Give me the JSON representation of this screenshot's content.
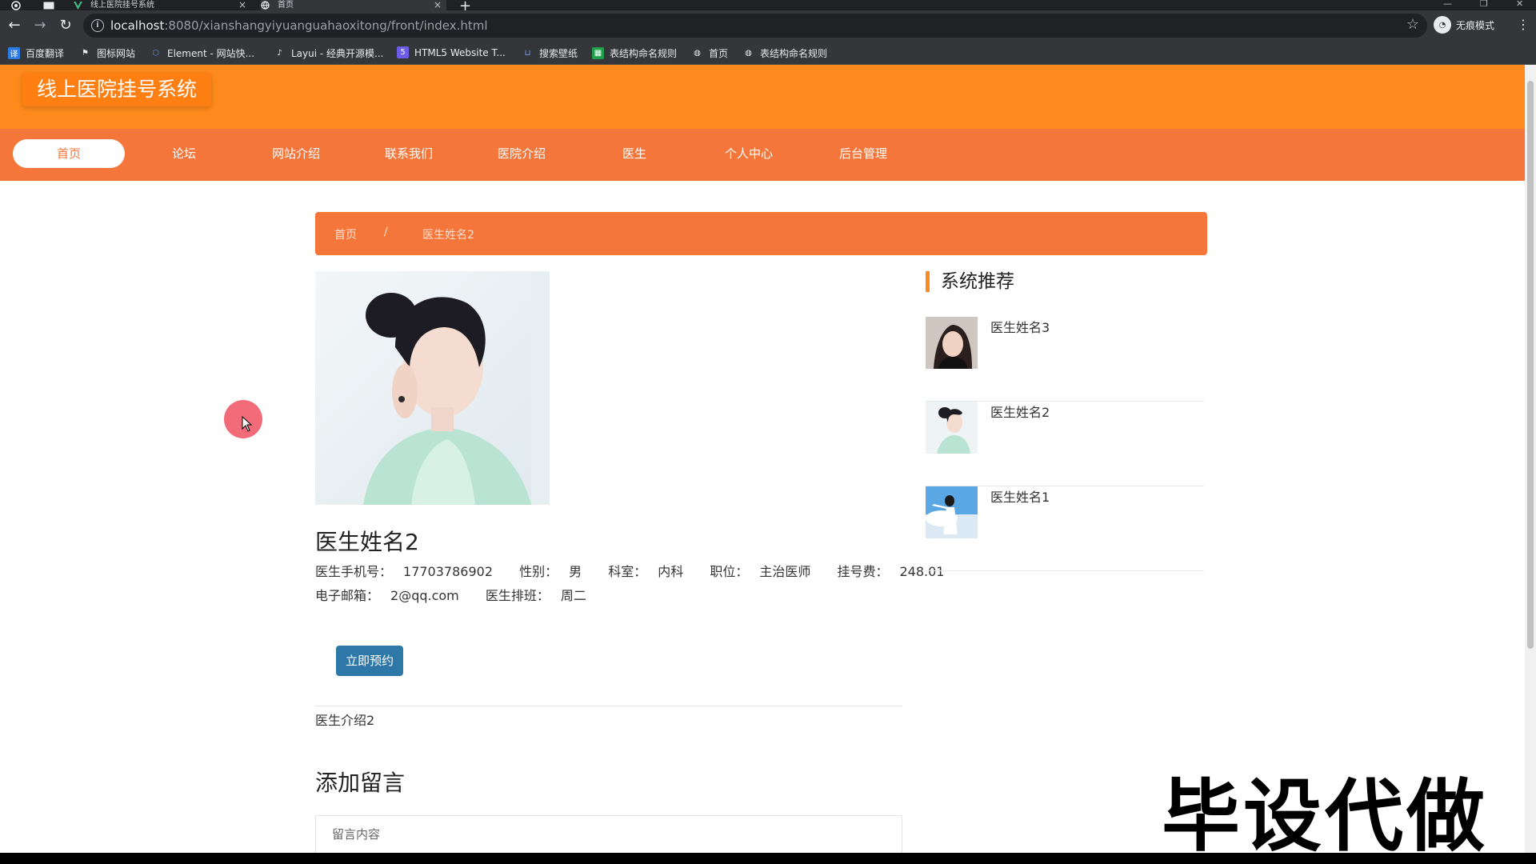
{
  "browser": {
    "tabs": [
      {
        "title": "线上医院挂号系统"
      },
      {
        "title": "首页"
      }
    ],
    "new_tab": "+",
    "url": {
      "host": "localhost",
      "path": ":8080/xianshangyiyuanguahaoxitong/front/index.html"
    },
    "profile_label": "无痕模式",
    "bookmarks": [
      {
        "label": "百度翻译",
        "icon": "translate-icon",
        "color": "#2b7be4"
      },
      {
        "label": "图标网站",
        "icon": "flag-icon",
        "color": "#444444"
      },
      {
        "label": "Element - 网站快...",
        "icon": "element-icon",
        "color": "#4f8de6"
      },
      {
        "label": "Layui - 经典开源模...",
        "icon": "layui-icon",
        "color": "#555555"
      },
      {
        "label": "HTML5 Website T...",
        "icon": "html5-icon",
        "color": "#6d5ce7"
      },
      {
        "label": "搜索壁纸",
        "icon": "wallpaper-icon",
        "color": "#3b6bd6"
      },
      {
        "label": "表结构命名规则",
        "icon": "sheet-icon",
        "color": "#1e9e4a"
      },
      {
        "label": "首页",
        "icon": "globe-icon",
        "color": "#777777"
      },
      {
        "label": "表结构命名规则",
        "icon": "globe-icon",
        "color": "#777777"
      }
    ]
  },
  "site": {
    "title": "线上医院挂号系统",
    "nav": [
      {
        "label": "首页",
        "active": true
      },
      {
        "label": "论坛"
      },
      {
        "label": "网站介绍"
      },
      {
        "label": "联系我们"
      },
      {
        "label": "医院介绍"
      },
      {
        "label": "医生"
      },
      {
        "label": "个人中心"
      },
      {
        "label": "后台管理"
      }
    ],
    "colors": {
      "header": "#fd8a1c",
      "nav": "#f5763a",
      "button": "#2e78a8"
    }
  },
  "breadcrumb": {
    "home": "首页",
    "sep": "/",
    "current": "医生姓名2"
  },
  "doctor": {
    "name": "医生姓名2",
    "phone_label": "医生手机号：",
    "phone": "17703786902",
    "gender_label": "性别：",
    "gender": "男",
    "dept_label": "科室：",
    "dept": "内科",
    "title_label": "职位：",
    "title": "主治医师",
    "fee_label": "挂号费：",
    "fee": "248.01",
    "email_label": "电子邮箱：",
    "email": "2@qq.com",
    "schedule_label": "医生排班：",
    "schedule": "周二",
    "book_button": "立即预约",
    "intro": "医生介绍2"
  },
  "message": {
    "title": "添加留言",
    "placeholder": "留言内容"
  },
  "recommend": {
    "title": "系统推荐",
    "items": [
      {
        "name": "医生姓名3"
      },
      {
        "name": "医生姓名2"
      },
      {
        "name": "医生姓名1"
      }
    ]
  },
  "watermark": "毕设代做"
}
